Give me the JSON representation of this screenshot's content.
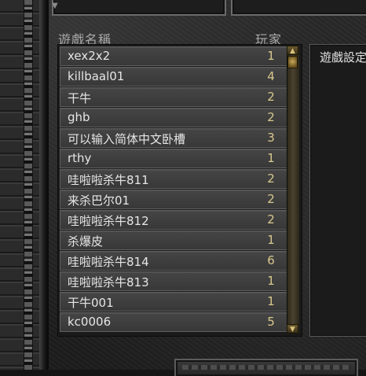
{
  "headers": {
    "game_name": "遊戲名稱",
    "players": "玩家"
  },
  "games": [
    {
      "name": "xex2x2",
      "players": "1"
    },
    {
      "name": "killbaal01",
      "players": "4"
    },
    {
      "name": "干牛",
      "players": "2"
    },
    {
      "name": "ghb",
      "players": "2"
    },
    {
      "name": "可以输入简体中文卧槽",
      "players": "3"
    },
    {
      "name": "rthy",
      "players": "1"
    },
    {
      "name": "哇啦啦杀牛811",
      "players": "2"
    },
    {
      "name": "来杀巴尔01",
      "players": "2"
    },
    {
      "name": "哇啦啦杀牛812",
      "players": "2"
    },
    {
      "name": "杀爆皮",
      "players": "1"
    },
    {
      "name": "哇啦啦杀牛814",
      "players": "6"
    },
    {
      "name": "哇啦啦杀牛813",
      "players": "1"
    },
    {
      "name": "干牛001",
      "players": "1"
    },
    {
      "name": "kc0006",
      "players": "5"
    }
  ],
  "settings_panel": {
    "title": "遊戲設定"
  },
  "icons": {
    "scroll_up": "scroll-up-arrow-icon",
    "scroll_down": "scroll-down-arrow-icon",
    "top_arrow": "dropdown-arrow-icon"
  },
  "colors": {
    "player_count": "#d8c88e",
    "row_text": "#e6e6e6",
    "header_text": "#a9a9a9"
  }
}
